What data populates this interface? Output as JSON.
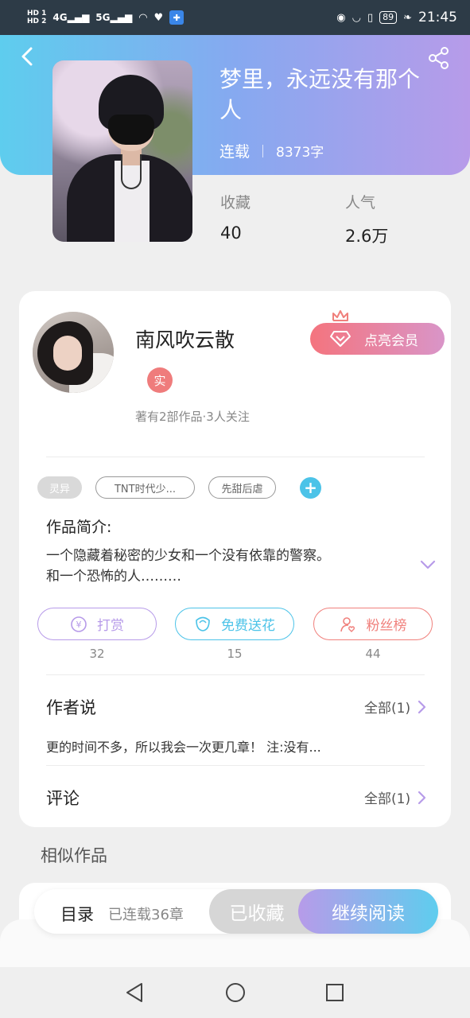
{
  "status_bar": {
    "hd1": "HD 1",
    "hd2": "HD 2",
    "signal1": "4G",
    "signal2": "5G",
    "battery": "89",
    "time": "21:45"
  },
  "book": {
    "title": "梦里，永远没有那个人",
    "status": "连载",
    "word_count": "8373字",
    "favorites_label": "收藏",
    "favorites_value": "40",
    "popularity_label": "人气",
    "popularity_value": "2.6万"
  },
  "author": {
    "name": "南风吹云散",
    "badge": "实",
    "meta": "著有2部作品·3人关注",
    "vip_button": "点亮会员"
  },
  "tags": [
    "灵异",
    "TNT时代少...",
    "先甜后虐"
  ],
  "intro": {
    "heading": "作品简介:",
    "line1": "一个隐藏着秘密的少女和一个没有依靠的警察。",
    "line2": "和一个恐怖的人………"
  },
  "actions": [
    {
      "label": "打赏",
      "count": "32",
      "color": "#b79be9"
    },
    {
      "label": "免费送花",
      "count": "15",
      "color": "#4cc3e8"
    },
    {
      "label": "粉丝榜",
      "count": "44",
      "color": "#f0807c"
    }
  ],
  "author_says": {
    "title": "作者说",
    "more": "全部(1)",
    "note": "更的时间不多，所以我会一次更几章！ 注:没有..."
  },
  "comments": {
    "title": "评论",
    "more": "全部(1)"
  },
  "similar": {
    "heading": "相似作品"
  },
  "bottom_bar": {
    "toc": "目录",
    "toc_count": "已连载36章",
    "collected": "已收藏",
    "continue": "继续阅读"
  },
  "colors": {
    "header_start": "#5ecdee",
    "header_end": "#b79be9",
    "vip_start": "#f4747e",
    "accent_blue": "#4cc3e8"
  }
}
